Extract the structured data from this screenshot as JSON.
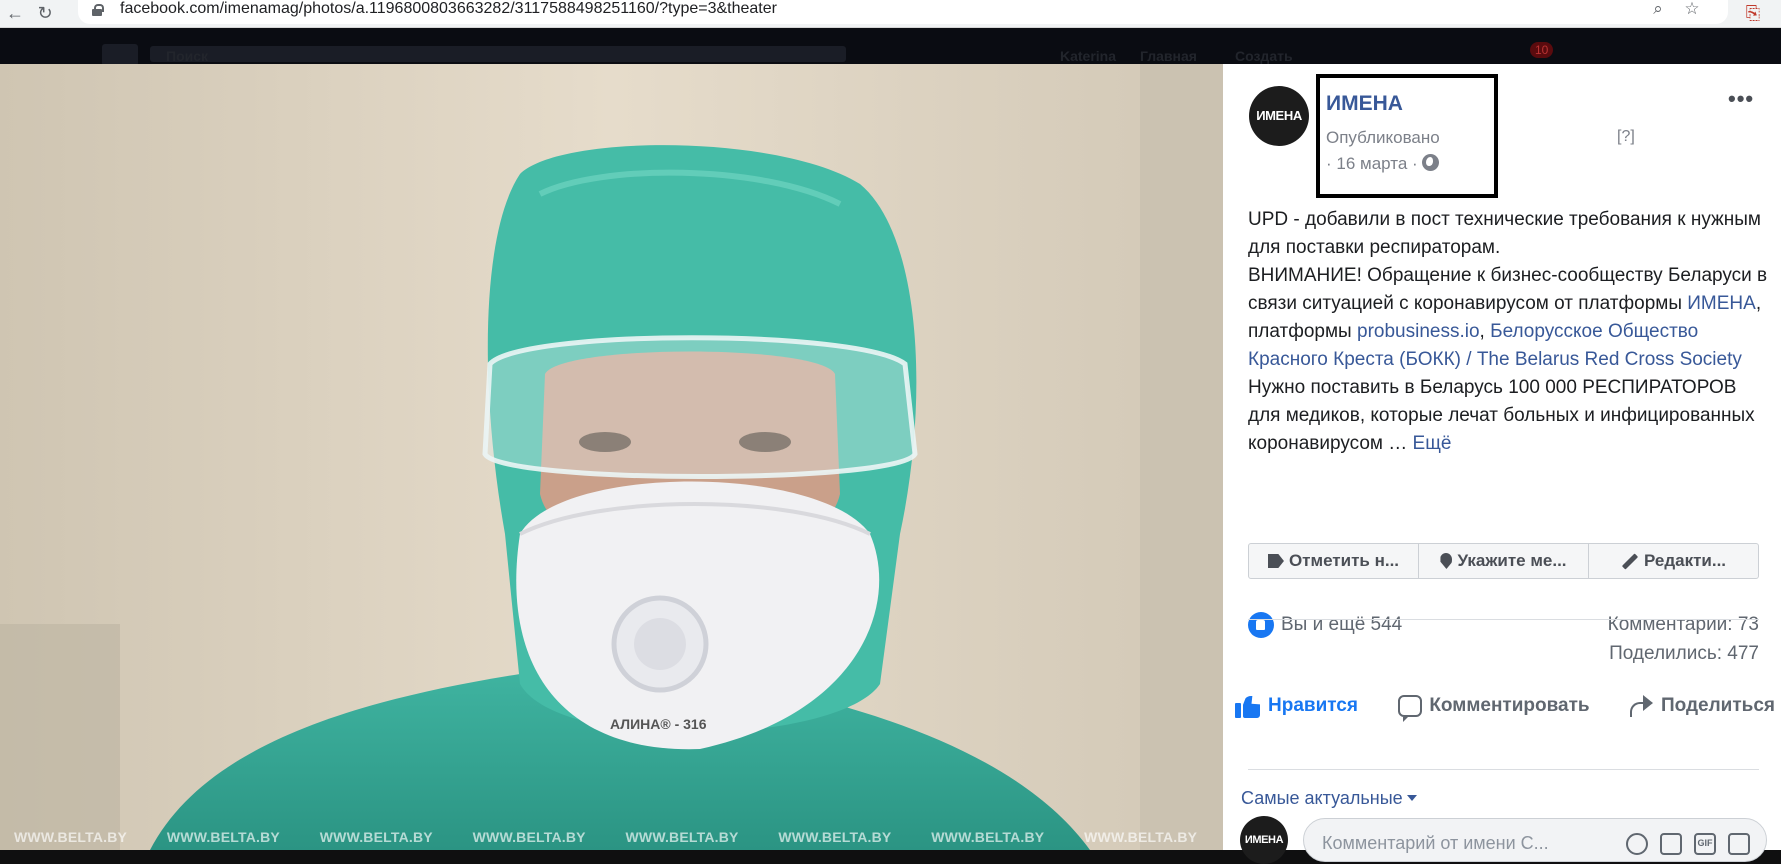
{
  "browser": {
    "url": "facebook.com/imenamag/photos/a.1196800803663282/3117588498251160/?type=3&theater",
    "back_icon": "←",
    "reload_icon": "↻",
    "zoom_icon": "🔍",
    "star_icon": "☆"
  },
  "fb_header": {
    "search_placeholder": "Поиск",
    "user_name": "Katerina",
    "home_label": "Главная",
    "create_label": "Создать",
    "notifications_count": "10"
  },
  "photo": {
    "watermarks": [
      "WWW.BELTA.BY",
      "WWW.BELTA.BY",
      "WWW.BELTA.BY",
      "WWW.BELTA.BY",
      "WWW.BELTA.BY",
      "WWW.BELTA.BY",
      "WWW.BELTA.BY",
      "WWW.BELTA.BY"
    ],
    "mask_label": "АЛИНА® - 316"
  },
  "post": {
    "avatar_label": "ИМЕНА",
    "page_name": "ИМЕНА",
    "published_label": "Опубликовано",
    "date_label": "· 16 марта ·",
    "help_label": "[?]",
    "more_icon": "•••",
    "text": {
      "p1": "UPD - добавили в пост технические требования к нужным для поставки респираторам.",
      "p2_start": "ВНИМАНИЕ! Обращение к бизнес-сообществу Беларуси в связи ситуацией с коронавирусом от платформы ",
      "link_imena": "ИМЕНА",
      "p2_mid": ", платформы ",
      "link_probusiness": "probusiness.io",
      "p2_comma": ",",
      "link_redcross": "Белорусское Общество Красного Креста (БОКК) / The Belarus Red Cross Society",
      "p2_end": " Нужно поставить в Беларусь 100 000 РЕСПИРАТОРОВ для медиков, которые лечат больных и инфицированных коронавирусом … ",
      "see_more": "Ещё"
    }
  },
  "actions": {
    "tag_label": "Отметить н...",
    "location_label": "Укажите ме...",
    "edit_label": "Редакти..."
  },
  "stats": {
    "likes_text": "Вы и ещё 544",
    "comments_text": "Комментарии: 73",
    "shares_text": "Поделились: 477"
  },
  "reaction_bar": {
    "like_label": "Нравится",
    "comment_label": "Комментировать",
    "share_label": "Поделиться"
  },
  "comments": {
    "sort_label": "Самые актуальные",
    "avatar_label": "ИМЕНА",
    "placeholder": "Комментарий от имени С...",
    "gif_label": "GIF"
  },
  "colors": {
    "link": "#385898",
    "like_blue": "#1877f2"
  }
}
